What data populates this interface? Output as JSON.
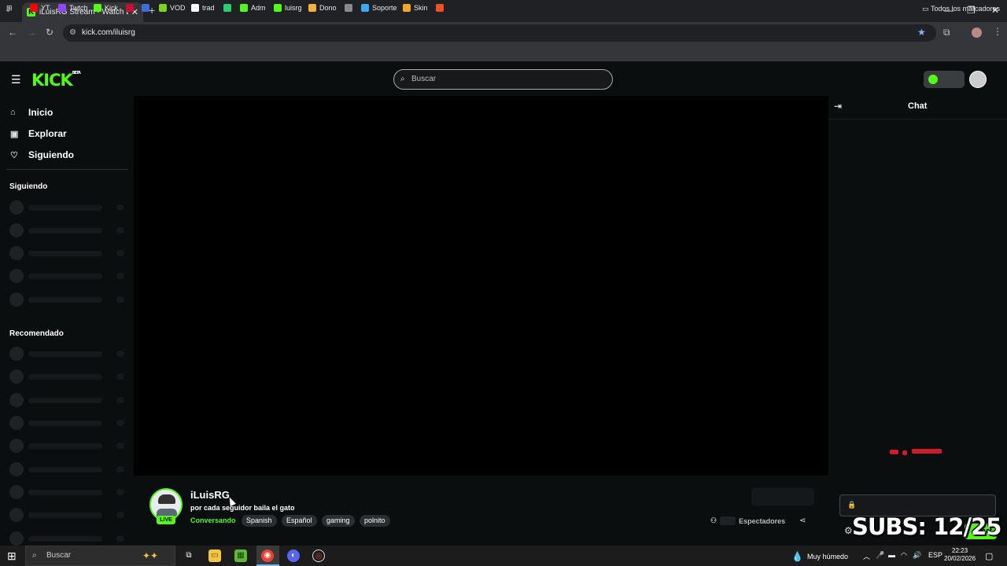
{
  "browser": {
    "tab_title": "iLuisRG Stream - Watch Live on",
    "tab_favicon": "K",
    "url": "kick.com/iluisrg",
    "bookmarks": [
      {
        "label": "YT",
        "color": "#ff0000"
      },
      {
        "label": "Twtch",
        "color": "#9146ff"
      },
      {
        "label": "Kick",
        "color": "#53fc18"
      },
      {
        "label": "",
        "color": "#c8102e"
      },
      {
        "label": "",
        "color": "#3b6ed8"
      },
      {
        "label": "VOD",
        "color": "#7bd320"
      },
      {
        "label": "trad",
        "color": "#ffffff"
      },
      {
        "label": "",
        "color": "#2ecc71"
      },
      {
        "label": "Adm",
        "color": "#53fc18"
      },
      {
        "label": "luisrg",
        "color": "#53fc18"
      },
      {
        "label": "Dono",
        "color": "#f2b33d"
      },
      {
        "label": "",
        "color": "#8a8a8a"
      },
      {
        "label": "Soporte",
        "color": "#3ea6ff"
      },
      {
        "label": "Skin",
        "color": "#f5a623"
      },
      {
        "label": "",
        "color": "#f25022"
      }
    ],
    "all_bookmarks_label": "Todos los marcadores"
  },
  "kick": {
    "logo": "KICK",
    "logo_badge": "BETA",
    "search_placeholder": "Buscar",
    "brand_color": "#53fc18"
  },
  "sidebar": {
    "nav": [
      {
        "label": "Inicio",
        "icon": "home-icon"
      },
      {
        "label": "Explorar",
        "icon": "browse-icon"
      },
      {
        "label": "Siguiendo",
        "icon": "heart-icon"
      }
    ],
    "following_heading": "Siguiendo",
    "recommended_heading": "Recomendado"
  },
  "chat": {
    "title": "Chat",
    "send_label": "hat"
  },
  "overlay": {
    "subs_text": "SUBS: 12/25"
  },
  "channel": {
    "name": "iLuisRG",
    "live_badge": "LIVE",
    "stream_title": "por cada seguidor baila el gato",
    "category": "Conversando",
    "tags": [
      "Spanish",
      "Español",
      "gaming",
      "polnito"
    ],
    "viewers_label": "Espectadores"
  },
  "taskbar": {
    "search_placeholder": "Buscar",
    "weather": "Muy húmedo",
    "language": "ESP",
    "time": "22:23",
    "date": "20/02/2026"
  }
}
